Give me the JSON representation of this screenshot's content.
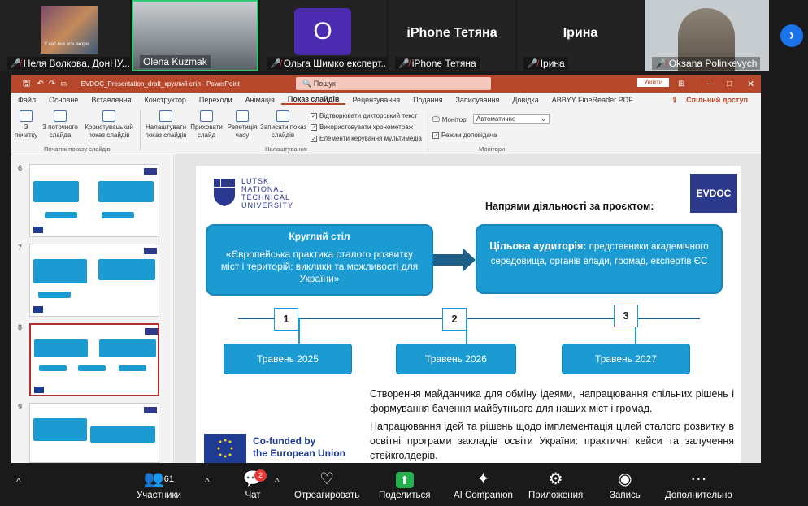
{
  "participants": [
    {
      "name": "Неля Волкова, ДонНУ...",
      "muted": true
    },
    {
      "name": "Olena Kuzmak",
      "muted": false,
      "active": true
    },
    {
      "name": "Ольга Шимко експерт...",
      "muted": true,
      "initial": "O"
    },
    {
      "name": "iPhone Тетяна",
      "muted": true,
      "display": "iPhone Тетяна"
    },
    {
      "name": "Ірина",
      "muted": true,
      "display": "Ірина"
    },
    {
      "name": "Oksana Polinkevych",
      "muted": true
    }
  ],
  "tile_caption": "У нас все все вкоре",
  "ppt": {
    "title": "EVDOC_Presentation_draft_круглий стіл  -  PowerPoint",
    "search_placeholder": "Пошук",
    "signin": "Увійти",
    "menu": [
      "Файл",
      "Основне",
      "Вставлення",
      "Конструктор",
      "Переходи",
      "Анімація",
      "Показ слайдів",
      "Рецензування",
      "Подання",
      "Записування",
      "Довідка",
      "ABBYY FineReader PDF"
    ],
    "share": "Спільний доступ",
    "ribbon": {
      "from_start": "З\nпочатку",
      "from_current": "З поточного\nслайда",
      "custom_show": "Користувацький\nпоказ слайдів",
      "setup_show": "Налаштувати\nпоказ слайдів",
      "hide_slide": "Приховати\nслайд",
      "rehearse": "Репетиція\nчасу",
      "record": "Записати показ\nслайдів",
      "play_narrations": "Відтворювати дикторський текст",
      "use_timings": "Використовувати хронометраж",
      "show_media": "Елементи керування мультимедіа",
      "monitor_label": "Монітор:",
      "monitor_value": "Автоматично",
      "presenter_view": "Режим доповідача",
      "group_start": "Початок показу слайдів",
      "group_setup": "Налаштування",
      "group_monitors": "Монітори"
    },
    "thumb_numbers": [
      "6",
      "7",
      "8",
      "9"
    ]
  },
  "slide": {
    "univ_name": [
      "LUTSK",
      "NATIONAL",
      "TECHNICAL",
      "UNIVERSITY"
    ],
    "logo": "EVDOC",
    "heading": "Напрями діяльності за проєктом:",
    "left_bubble_title": "Круглий стіл",
    "left_bubble_text": "«Європейська практика сталого розвитку міст і територій: виклики та можливості для України»",
    "right_bubble_bold": "Цільова аудиторія:",
    "right_bubble_text": " представники академічного середовища, органів влади, громад, експертів ЄС",
    "timeline": [
      {
        "num": "1",
        "label": "Травень 2025"
      },
      {
        "num": "2",
        "label": "Травень 2026"
      },
      {
        "num": "3",
        "label": "Травень 2027"
      }
    ],
    "paragraph1": "Створення майданчика для обміну ідеями, напрацювання спільних рішень і формування бачення майбутнього для наших міст і громад.",
    "paragraph2": "Напрацювання ідей та рішень щодо імплементація цілей сталого розвитку в освітні програми закладів освіти України: практичні кейси та залучення стейкголдерів.",
    "eu_line1": "Co-funded by",
    "eu_line2": "the European Union"
  },
  "toolbar": {
    "participants_label": "Участники",
    "participants_count": "61",
    "chat_label": "Чат",
    "chat_badge": "2",
    "react_label": "Отреагировать",
    "share_label": "Поделиться",
    "ai_label": "AI Companion",
    "apps_label": "Приложения",
    "record_label": "Запись",
    "more_label": "Дополнительно"
  },
  "colors": {
    "accent": "#1b9bd1",
    "ppt_red": "#b7472a",
    "share_green": "#22b14c"
  }
}
